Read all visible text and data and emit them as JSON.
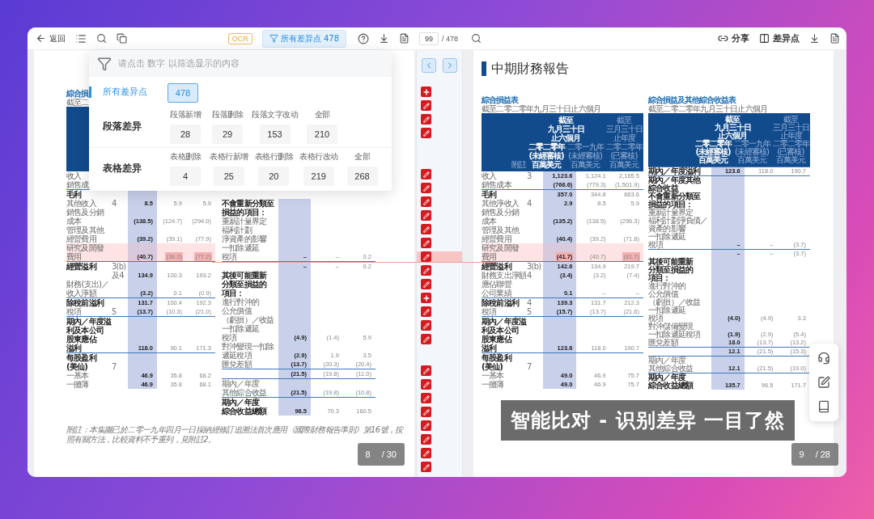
{
  "left_toolbar": {
    "back": "返回",
    "ocr": "OCR",
    "filter_button": {
      "label": "所有差异点 478",
      "selected": true
    }
  },
  "page_nav": {
    "value": "99",
    "total": "/ 478"
  },
  "right_toolbar": {
    "share": "分享",
    "diff_points": "差异点"
  },
  "filter_popup": {
    "hint": "请点击 数字 以筛选显示的内容",
    "all": {
      "label": "所有差异点",
      "count": "478",
      "selected": true
    },
    "groups": [
      {
        "title": "段落差异",
        "items": [
          {
            "label": "段落新增",
            "count": "28",
            "selected": false
          },
          {
            "label": "段落删除",
            "count": "29",
            "selected": false
          },
          {
            "label": "段落文字改动",
            "count": "153",
            "selected": false
          },
          {
            "label": "全部",
            "count": "210",
            "selected": false
          }
        ]
      },
      {
        "title": "表格差异",
        "items": [
          {
            "label": "表格删除",
            "count": "4",
            "selected": false
          },
          {
            "label": "表格行新增",
            "count": "25",
            "selected": false
          },
          {
            "label": "表格行删除",
            "count": "20",
            "selected": false
          },
          {
            "label": "表格行改动",
            "count": "219",
            "selected": false
          },
          {
            "label": "全部",
            "count": "268",
            "selected": false
          }
        ]
      }
    ]
  },
  "diff_markers": [
    [
      {
        "kind": "add",
        "selected": false
      },
      {
        "kind": "edit",
        "selected": false
      },
      {
        "kind": "edit",
        "selected": false
      },
      {
        "kind": "edit",
        "selected": false
      }
    ],
    [
      {
        "kind": "edit",
        "selected": false
      },
      {
        "kind": "edit",
        "selected": false
      },
      {
        "kind": "edit",
        "selected": false
      },
      {
        "kind": "edit",
        "selected": false
      },
      {
        "kind": "edit",
        "selected": false
      },
      {
        "kind": "edit",
        "selected": false
      },
      {
        "kind": "edit",
        "selected": true
      },
      {
        "kind": "edit",
        "selected": false
      },
      {
        "kind": "edit",
        "selected": false
      },
      {
        "kind": "add",
        "selected": false
      },
      {
        "kind": "edit",
        "selected": false
      },
      {
        "kind": "edit",
        "selected": false
      },
      {
        "kind": "edit",
        "selected": false
      }
    ],
    [
      {
        "kind": "edit",
        "selected": false
      },
      {
        "kind": "edit",
        "selected": false
      },
      {
        "kind": "edit",
        "selected": false
      },
      {
        "kind": "edit",
        "selected": false
      },
      {
        "kind": "edit",
        "selected": false
      },
      {
        "kind": "edit",
        "selected": false
      },
      {
        "kind": "edit",
        "selected": false
      },
      {
        "kind": "edit",
        "selected": false
      }
    ]
  ],
  "left_page": {
    "tables": [
      {
        "title": "綜合損",
        "subtitle": "截至二",
        "rows": [
          {
            "label": [
              "收入"
            ],
            "kind": "item",
            "highlight": false
          },
          {
            "label": [
              "銷售成"
            ],
            "kind": "item",
            "highlight": false
          },
          {
            "label": [
              "毛利"
            ],
            "kind": "total",
            "highlight": false
          },
          {
            "label": [
              "其他收入"
            ],
            "note": [
              "4"
            ],
            "values": [
              "8.5",
              "5.9",
              "5.9"
            ],
            "kind": "item",
            "highlight": false
          },
          {
            "label": [
              "銷售及分銷",
              "成本"
            ],
            "values": [
              "(138.5)",
              "(124.7)",
              "(294.0)"
            ],
            "kind": "item",
            "highlight": false
          },
          {
            "label": [
              "管理及其他",
              "經營費用"
            ],
            "values": [
              "(39.2)",
              "(39.1)",
              "(77.9)"
            ],
            "kind": "item",
            "highlight": false
          },
          {
            "label": [
              "研究及開發",
              "費用"
            ],
            "values": [
              {
                "text": "(40.7)",
                "changed": false
              },
              {
                "text": "(38.3)",
                "changed": true
              },
              {
                "text": "(77.2)",
                "changed": true
              }
            ],
            "kind": "item",
            "highlight": true
          },
          {
            "label": [
              "經營溢利"
            ],
            "note": [
              "3(b)",
              "及4"
            ],
            "values": [
              "134.9",
              "100.3",
              "193.2"
            ],
            "kind": "total",
            "highlight": false
          },
          {
            "label": [
              "財務(支出)／",
              "收入淨額"
            ],
            "values": [
              "(3.2)",
              "0.1",
              "(0.9)"
            ],
            "kind": "item",
            "highlight": false
          },
          {
            "label": [
              "除稅前溢利"
            ],
            "values": [
              "131.7",
              "100.4",
              "192.3"
            ],
            "kind": "total",
            "highlight": false
          },
          {
            "label": [
              "稅項"
            ],
            "note": [
              "5"
            ],
            "values": [
              "(13.7)",
              "(10.3)",
              "(21.0)"
            ],
            "kind": "item",
            "highlight": false
          },
          {
            "label": [
              "期內／年度溢",
              "利及本公司",
              "股東應佔",
              "溢利"
            ],
            "values": [
              "118.0",
              "90.1",
              "171.3"
            ],
            "kind": "total",
            "highlight": false
          },
          {
            "label": [
              "每股盈利",
              "(美仙)"
            ],
            "note": [
              "7"
            ],
            "kind": "total",
            "highlight": false
          },
          {
            "label": [
              "一基本"
            ],
            "values": [
              "46.9",
              "35.8",
              "68.2"
            ],
            "kind": "item",
            "highlight": false
          },
          {
            "label": [
              "一攤薄"
            ],
            "values": [
              "46.9",
              "35.8",
              "68.1"
            ],
            "kind": "item",
            "highlight": false
          }
        ]
      },
      {
        "rows": [
          {
            "label": [
              "不會重新分類至",
              "損益的項目："
            ],
            "kind": "heading",
            "highlight": false
          },
          {
            "label": [
              "重新計量界定",
              "福利計劃",
              "淨資產的影響",
              "一扣除遞延",
              "稅項"
            ],
            "values": [
              "–",
              "–",
              "0.2"
            ],
            "kind": "item",
            "highlight": false
          },
          {
            "values": [
              "–",
              "–",
              "0.2"
            ],
            "kind": "subtotal",
            "highlight": false
          },
          {
            "label": [
              "其後可能重新",
              "分類至損益的",
              "項目："
            ],
            "kind": "heading",
            "highlight": false
          },
          {
            "label": [
              "進行對沖的",
              "公允價值",
              "（虧損）／收益",
              "一扣除遞延",
              "稅項"
            ],
            "values": [
              "(4.9)",
              "(1.4)",
              "5.9"
            ],
            "kind": "item",
            "highlight": false
          },
          {
            "label": [
              "對沖變現一扣除",
              "遞延稅項"
            ],
            "values": [
              "(2.9)",
              "1.9",
              "3.5"
            ],
            "kind": "item",
            "highlight": false
          },
          {
            "label": [
              "匯兌差額"
            ],
            "values": [
              "(13.7)",
              "(20.3)",
              "(20.4)"
            ],
            "kind": "item",
            "highlight": false
          },
          {
            "values": [
              "(21.5)",
              "(19.8)",
              "(11.0)"
            ],
            "kind": "subtotal",
            "highlight": false
          },
          {
            "label": [
              "期內／年度",
              "其他綜合收益"
            ],
            "values": [
              "(21.5)",
              "(19.8)",
              "(10.8)"
            ],
            "kind": "subtotal",
            "highlight": false
          },
          {
            "label": [
              "期內／年度",
              "綜合收益總額"
            ],
            "values": [
              "96.5",
              "70.3",
              "160.5"
            ],
            "kind": "total",
            "highlight": false
          }
        ]
      }
    ],
    "footnote": "附註：本集團已於二零一九年四月一日採納經修訂追溯法首次應用《國際財務報告準則》第16號，按照有關方法，比較資料不予重列，見附註2。",
    "pager": {
      "current": "8",
      "total": "/ 30"
    }
  },
  "right_page": {
    "title": "中期財務報告",
    "tables": [
      {
        "title": "綜合損益表",
        "subtitle": "截至二零二零年九月三十日止六個月",
        "header": {
          "note": "附註",
          "span": [
            "截至",
            "九月三十日",
            "止六個月"
          ],
          "columns": [
            [
              "二零二零年",
              "(未經審核)",
              "百萬美元"
            ],
            [
              "二零一九年",
              "(未經審核)",
              "百萬美元"
            ],
            [
              "截至",
              "三月三十日",
              "止年度",
              "二零二零年",
              "(已審核)",
              "百萬美元"
            ]
          ]
        },
        "rows": [
          {
            "label": [
              "收入"
            ],
            "note": [
              "3"
            ],
            "values": [
              "1,123.6",
              "1,124.1",
              "2,165.5"
            ],
            "kind": "item",
            "highlight": false
          },
          {
            "label": [
              "銷售成本"
            ],
            "values": [
              "(766.6)",
              "(779.3)",
              "(1,501.9)"
            ],
            "kind": "item",
            "highlight": false
          },
          {
            "label": [
              "毛利"
            ],
            "values": [
              "357.0",
              "344.8",
              "663.6"
            ],
            "kind": "total",
            "highlight": false
          },
          {
            "label": [
              "其他淨收入"
            ],
            "note": [
              "4"
            ],
            "values": [
              "2.9",
              "8.5",
              "5.9"
            ],
            "kind": "item",
            "highlight": false
          },
          {
            "label": [
              "銷售及分銷",
              "成本"
            ],
            "values": [
              "(135.2)",
              "(138.5)",
              "(296.3)"
            ],
            "kind": "item",
            "highlight": false
          },
          {
            "label": [
              "管理及其他",
              "經營費用"
            ],
            "values": [
              "(40.4)",
              "(39.2)",
              "(71.8)"
            ],
            "kind": "item",
            "highlight": false
          },
          {
            "label": [
              "研究及開發",
              "費用"
            ],
            "values": [
              {
                "text": "(41.7)",
                "changed": true
              },
              {
                "text": "(40.7)",
                "changed": false
              },
              {
                "text": "(81.7)",
                "changed": true
              }
            ],
            "kind": "item",
            "highlight": true
          },
          {
            "label": [
              "經營溢利"
            ],
            "note": [
              "3(b)"
            ],
            "values": [
              "142.6",
              "134.9",
              "219.7"
            ],
            "kind": "total",
            "highlight": false
          },
          {
            "label": [
              "財務支出淨額"
            ],
            "note": [
              "4"
            ],
            "values": [
              "(3.4)",
              "(3.2)",
              "(7.4)"
            ],
            "kind": "item",
            "highlight": false
          },
          {
            "label": [
              "應佔聯營",
              "公司業績"
            ],
            "values": [
              "0.1",
              "–",
              "–"
            ],
            "kind": "item",
            "highlight": false
          },
          {
            "label": [
              "除稅前溢利"
            ],
            "note": [
              "4"
            ],
            "values": [
              "139.3",
              "131.7",
              "212.3"
            ],
            "kind": "total",
            "highlight": false
          },
          {
            "label": [
              "稅項"
            ],
            "note": [
              "5"
            ],
            "values": [
              "(15.7)",
              "(13.7)",
              "(21.6)"
            ],
            "kind": "item",
            "highlight": false
          },
          {
            "label": [
              "期內／年度溢",
              "利及本公司",
              "股東應佔",
              "溢利"
            ],
            "values": [
              "123.6",
              "118.0",
              "190.7"
            ],
            "kind": "total",
            "highlight": false
          },
          {
            "label": [
              "每股盈利",
              "(美仙)"
            ],
            "note": [
              "7"
            ],
            "kind": "total",
            "highlight": false
          },
          {
            "label": [
              "一基本"
            ],
            "values": [
              "49.0",
              "46.9",
              "75.7"
            ],
            "kind": "item",
            "highlight": false
          },
          {
            "label": [
              "一攤薄"
            ],
            "values": [
              "49.0",
              "46.9",
              "75.7"
            ],
            "kind": "item",
            "highlight": false
          }
        ]
      },
      {
        "title": "綜合損益及其他綜合收益表",
        "subtitle": "截至二零二零年九月三十日止六個月",
        "header": {
          "span": [
            "截至",
            "九月三十日",
            "止六個月"
          ],
          "columns": [
            [
              "二零二零年",
              "(未經審核)",
              "百萬美元"
            ],
            [
              "二零一九年",
              "(未經審核)",
              "百萬美元"
            ],
            [
              "截至",
              "三月三十日",
              "止年度",
              "二零二零年",
              "(已審核)",
              "百萬美元"
            ]
          ]
        },
        "rows": [
          {
            "label": [
              "期內／年度溢利"
            ],
            "values": [
              "123.6",
              "118.0",
              "190.7"
            ],
            "kind": "total",
            "highlight": false
          },
          {
            "label": [
              "期內／年度其他",
              "綜合收益"
            ],
            "kind": "total",
            "highlight": false
          },
          {
            "label": [
              "不會重新分類至",
              "損益的項目："
            ],
            "kind": "heading",
            "highlight": false
          },
          {
            "label": [
              "重新計量界定",
              "福利計劃淨負債／",
              "資產的影響",
              "一扣除遞延",
              "稅項"
            ],
            "values": [
              "–",
              "–",
              "(3.7)"
            ],
            "kind": "item",
            "highlight": false
          },
          {
            "values": [
              "–",
              "–",
              "(3.7)"
            ],
            "kind": "subtotal",
            "highlight": false
          },
          {
            "label": [
              "其後可能重新",
              "分類至損益的",
              "項目："
            ],
            "kind": "heading",
            "highlight": false
          },
          {
            "label": [
              "進行對沖的",
              "公允價值",
              "（虧損）／收益",
              "一扣除遞延",
              "稅項"
            ],
            "values": [
              "(4.0)",
              "(4.9)",
              "3.3"
            ],
            "kind": "item",
            "highlight": false
          },
          {
            "label": [
              "對沖儲備變現",
              "一扣除遞延稅項"
            ],
            "values": [
              "(1.9)",
              "(2.9)",
              "(5.4)"
            ],
            "kind": "item",
            "highlight": false
          },
          {
            "label": [
              "匯兌差額"
            ],
            "values": [
              "18.0",
              "(13.7)",
              "(13.2)"
            ],
            "kind": "item",
            "highlight": false
          },
          {
            "values": [
              "12.1",
              "(21.5)",
              "(15.3)"
            ],
            "kind": "subtotal",
            "highlight": false
          },
          {
            "label": [
              "期內／年度",
              "其他綜合收益"
            ],
            "values": [
              "12.1",
              "(21.5)",
              "(19.0)"
            ],
            "kind": "subtotal",
            "highlight": false
          },
          {
            "label": [
              "期內／年度",
              "綜合收益總額"
            ],
            "values": [
              "135.7",
              "96.5",
              "171.7"
            ],
            "kind": "total",
            "highlight": false
          }
        ]
      }
    ],
    "pager": {
      "current": "9",
      "total": "/ 28"
    }
  },
  "caption": "智能比对 - 识别差异 一目了然"
}
